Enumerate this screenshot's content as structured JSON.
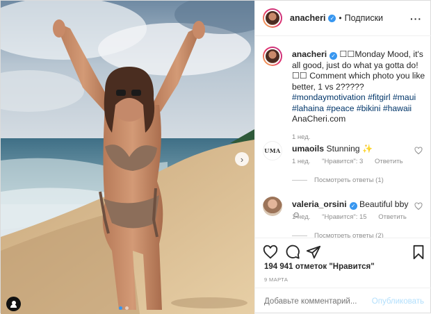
{
  "post": {
    "username": "anacheri",
    "follow_separator": "•",
    "follow_label": "Подписки",
    "more_icon": "ellipsis-icon",
    "verified_icon": "verified-badge-icon"
  },
  "caption": {
    "username": "anacheri",
    "text_main": " ☐☐Monday Mood, it's all good, just do what ya gotta do! ☐☐ Comment which photo you like better, 1 vs 2?????",
    "hashtags": [
      "#mondaymotivation",
      "#fitgirl",
      "#maui",
      "#lahaina",
      "#peace",
      "#bikini",
      "#hawaii"
    ],
    "link": "AnaCheri.com",
    "time": "1 нед."
  },
  "comments": [
    {
      "username": "umaoils",
      "avatar_text": "UMA",
      "text": "Stunning ✨",
      "time": "1 нед.",
      "likes": "\"Нравится\": 3",
      "reply": "Ответить",
      "view_replies": "Посмотреть ответы (1)"
    },
    {
      "username": "valeria_orsini",
      "text": "Beautiful bby☺",
      "time": "1 нед.",
      "likes": "\"Нравится\": 15",
      "reply": "Ответить",
      "view_replies": "Посмотреть ответы (2)"
    }
  ],
  "actions": {
    "like_icon": "heart-icon",
    "comment_icon": "comment-icon",
    "share_icon": "share-icon",
    "save_icon": "bookmark-icon",
    "likes_text": "194 941 отметок \"Нравится\"",
    "date": "9 МАРТА"
  },
  "add_comment": {
    "placeholder": "Добавьте комментарий...",
    "publish_label": "Опубликовать"
  },
  "media": {
    "carousel_total": 2,
    "carousel_active": 1,
    "next_icon": "chevron-right-icon",
    "tag_icon": "user-tag-icon"
  },
  "colors": {
    "accent": "#3897f0",
    "hashtag": "#003569",
    "muted": "#8e8e8e",
    "publish_disabled": "#b2dffc"
  }
}
